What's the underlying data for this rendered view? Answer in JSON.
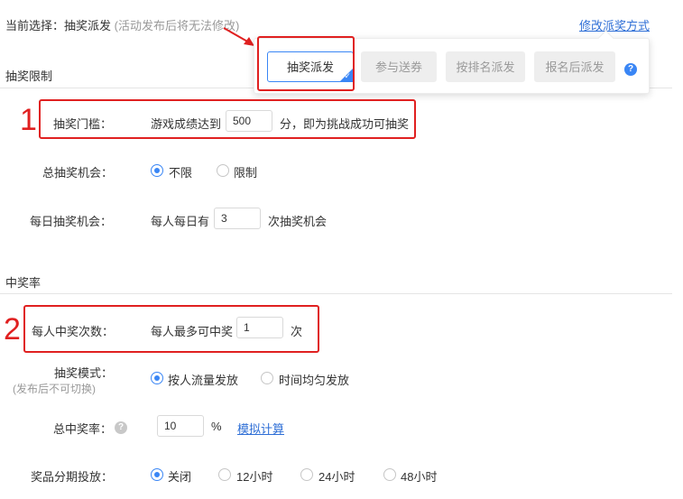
{
  "header": {
    "current_prefix": "当前选择：抽奖派发",
    "current_note": "(活动发布后将无法修改)",
    "modify_link": "修改派奖方式"
  },
  "popup": {
    "options": [
      {
        "label": "抽奖派发",
        "active": true
      },
      {
        "label": "参与送券",
        "active": false
      },
      {
        "label": "按排名派发",
        "active": false
      },
      {
        "label": "报名后派发",
        "active": false
      }
    ],
    "help": "?"
  },
  "lottery_limits": {
    "section_title": "抽奖限制",
    "threshold": {
      "label": "抽奖门槛：",
      "prefix": "游戏成绩达到",
      "value": "500",
      "suffix": "分，即为挑战成功可抽奖"
    },
    "total_chance": {
      "label": "总抽奖机会：",
      "options": [
        "不限",
        "限制"
      ],
      "selected": "不限"
    },
    "daily_chance": {
      "label": "每日抽奖机会：",
      "prefix": "每人每日有",
      "value": "3",
      "suffix": "次抽奖机会"
    }
  },
  "win_rate": {
    "section_title": "中奖率",
    "win_times": {
      "label": "每人中奖次数：",
      "prefix": "每人最多可中奖",
      "value": "1",
      "suffix": "次"
    },
    "mode": {
      "label": "抽奖模式：",
      "sublabel": "(发布后不可切换)",
      "options": [
        "按人流量发放",
        "时间均匀发放"
      ],
      "selected": "按人流量发放"
    },
    "total_rate": {
      "label": "总中奖率：",
      "value": "10",
      "unit": "%",
      "link": "模拟计算"
    },
    "staged": {
      "label": "奖品分期投放：",
      "options": [
        "关闭",
        "12小时",
        "24小时",
        "48小时"
      ],
      "selected": "关闭"
    }
  },
  "annotations": {
    "marker1": "1",
    "marker2": "2",
    "color": "#e02020"
  },
  "colors": {
    "accent": "#3a86f5",
    "link": "#2f6fd6",
    "annotation": "#e02020"
  }
}
